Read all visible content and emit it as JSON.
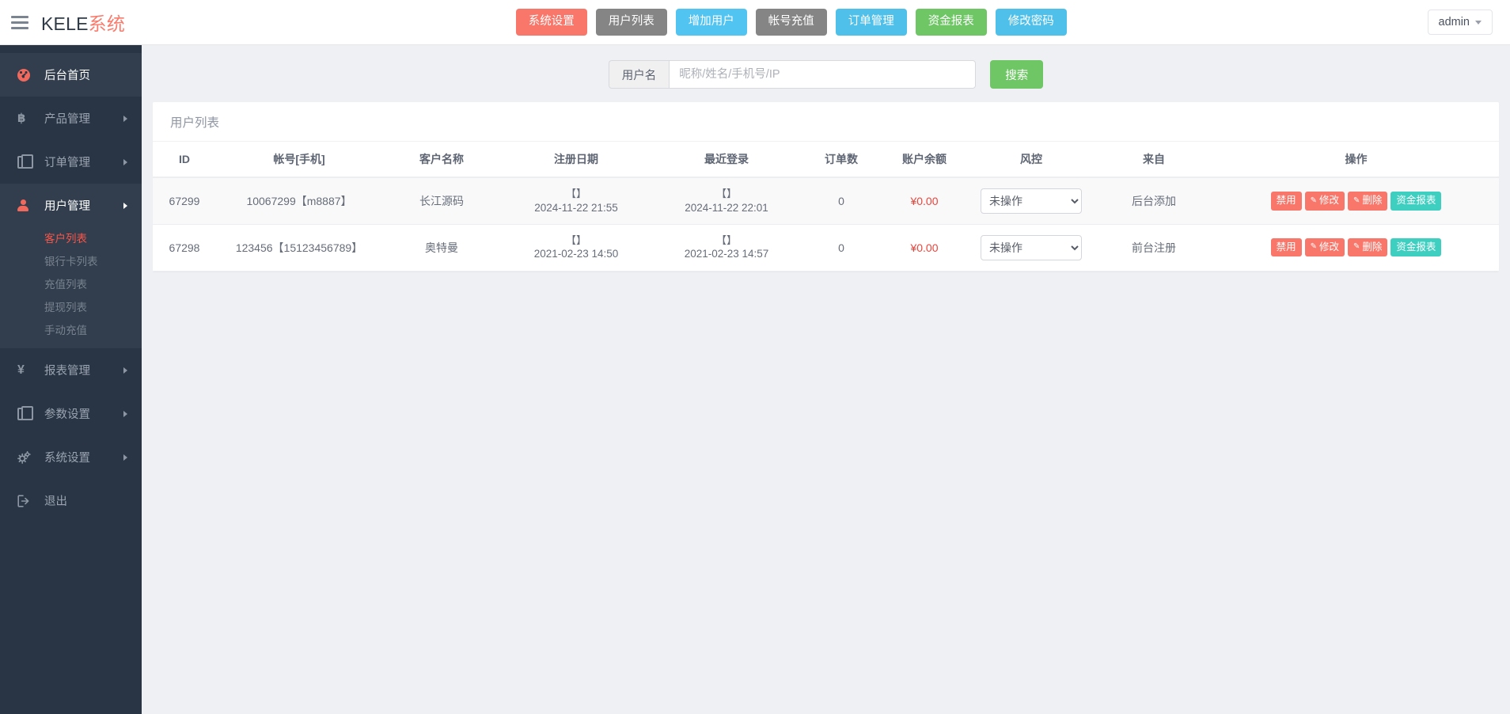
{
  "brand": {
    "name": "KELE",
    "accent": "系统",
    "accent_color": "#fa7b6c"
  },
  "navbar": {
    "menu_icon": "hamburger-icon",
    "buttons": [
      {
        "label": "系统设置",
        "color": "#f8776a",
        "style": "red"
      },
      {
        "label": "用户列表",
        "color": "#858585",
        "style": "gray"
      },
      {
        "label": "增加用户",
        "color": "#52c4f2",
        "style": "sky"
      },
      {
        "label": "帐号充值",
        "color": "#858585",
        "style": "gray"
      },
      {
        "label": "订单管理",
        "color": "#4fc0ea",
        "style": "blue"
      },
      {
        "label": "资金报表",
        "color": "#6ec664",
        "style": "green"
      },
      {
        "label": "修改密码",
        "color": "#4fc0ea",
        "style": "blue"
      }
    ],
    "account": {
      "label": "admin",
      "caret": "chevron-down-icon"
    }
  },
  "sidebar": {
    "items": [
      {
        "label": "后台首页",
        "icon": "dashboard-icon",
        "active": true,
        "has_arrow": false
      },
      {
        "label": "产品管理",
        "icon": "bitcoin-icon",
        "active": false,
        "has_arrow": true
      },
      {
        "label": "订单管理",
        "icon": "documents-icon",
        "active": false,
        "has_arrow": true
      },
      {
        "label": "用户管理",
        "icon": "user-icon",
        "active": true,
        "has_arrow": true,
        "submenu": [
          {
            "label": "客户列表",
            "active": true
          },
          {
            "label": "银行卡列表",
            "active": false
          },
          {
            "label": "充值列表",
            "active": false
          },
          {
            "label": "提现列表",
            "active": false
          },
          {
            "label": "手动充值",
            "active": false
          }
        ]
      },
      {
        "label": "报表管理",
        "icon": "yen-icon",
        "active": false,
        "has_arrow": true
      },
      {
        "label": "参数设置",
        "icon": "documents-icon",
        "active": false,
        "has_arrow": true
      },
      {
        "label": "系统设置",
        "icon": "gears-icon",
        "active": false,
        "has_arrow": true
      },
      {
        "label": "退出",
        "icon": "sign-out-icon",
        "active": false,
        "has_arrow": false
      }
    ]
  },
  "search": {
    "addon_label": "用户名",
    "placeholder": "昵称/姓名/手机号/IP",
    "value": "",
    "button_label": "搜索"
  },
  "panel": {
    "title": "用户列表",
    "columns": [
      "ID",
      "帐号[手机]",
      "客户名称",
      "注册日期",
      "最近登录",
      "订单数",
      "账户余额",
      "风控",
      "来自",
      "操作"
    ],
    "risk_options": [
      "未操作"
    ],
    "action_labels": {
      "disable": "禁用",
      "edit": "修改",
      "delete": "删除",
      "report": "资金报表"
    },
    "rows": [
      {
        "id": "67299",
        "account": "10067299【m8887】",
        "customer_name": "长江源码",
        "register_bracket": "【】",
        "register_date": "2024-11-22 21:55",
        "login_bracket": "【】",
        "login_date": "2024-11-22 22:01",
        "orders": "0",
        "balance": "¥0.00",
        "risk": "未操作",
        "from": "后台添加"
      },
      {
        "id": "67298",
        "account": "123456【15123456789】",
        "customer_name": "奥特曼",
        "register_bracket": "【】",
        "register_date": "2021-02-23 14:50",
        "login_bracket": "【】",
        "login_date": "2021-02-23 14:57",
        "orders": "0",
        "balance": "¥0.00",
        "risk": "未操作",
        "from": "前台注册"
      }
    ]
  }
}
